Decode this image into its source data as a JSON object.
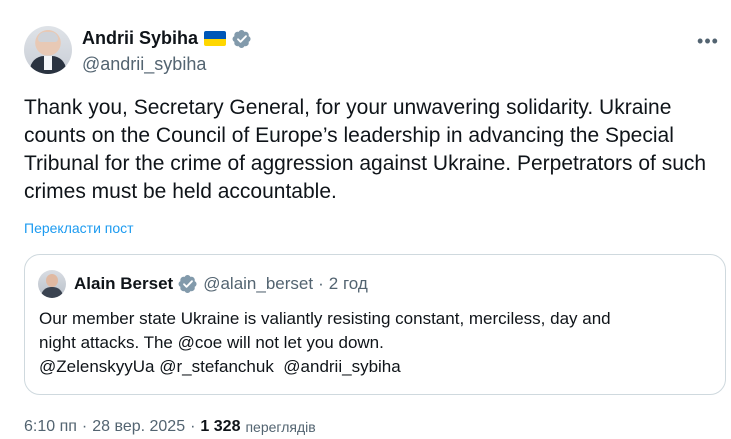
{
  "author": {
    "display_name": "Andrii Sybiha",
    "handle": "@andrii_sybiha",
    "flag": "ukraine-flag",
    "verified_color": "#829aab"
  },
  "tweet": {
    "text": "Thank you, Secretary General, for your unwavering solidarity. Ukraine counts on the Council of Europe’s leadership in advancing the Special Tribunal for the crime of aggression against Ukraine. Perpetrators of such crimes must be held accountable.",
    "translate_label": "Перекласти пост"
  },
  "quote": {
    "display_name": "Alain Berset",
    "handle": "@alain_berset",
    "separator": "·",
    "time": "2 год",
    "text_line1": "Our member state Ukraine is valiantly resisting constant, merciless, day and",
    "text_line2": "night attacks. The @coe will not let you down.",
    "text_line3": "@ZelenskyyUa @r_stefanchuk  @andrii_sybiha"
  },
  "footer": {
    "time": "6:10 пп",
    "sep1": "·",
    "date": "28 вер. 2025",
    "sep2": "·",
    "views_count": "1 328",
    "views_label": "переглядів"
  },
  "colors": {
    "link": "#1d9bf0",
    "muted": "#536471",
    "border": "#cfd9de"
  }
}
